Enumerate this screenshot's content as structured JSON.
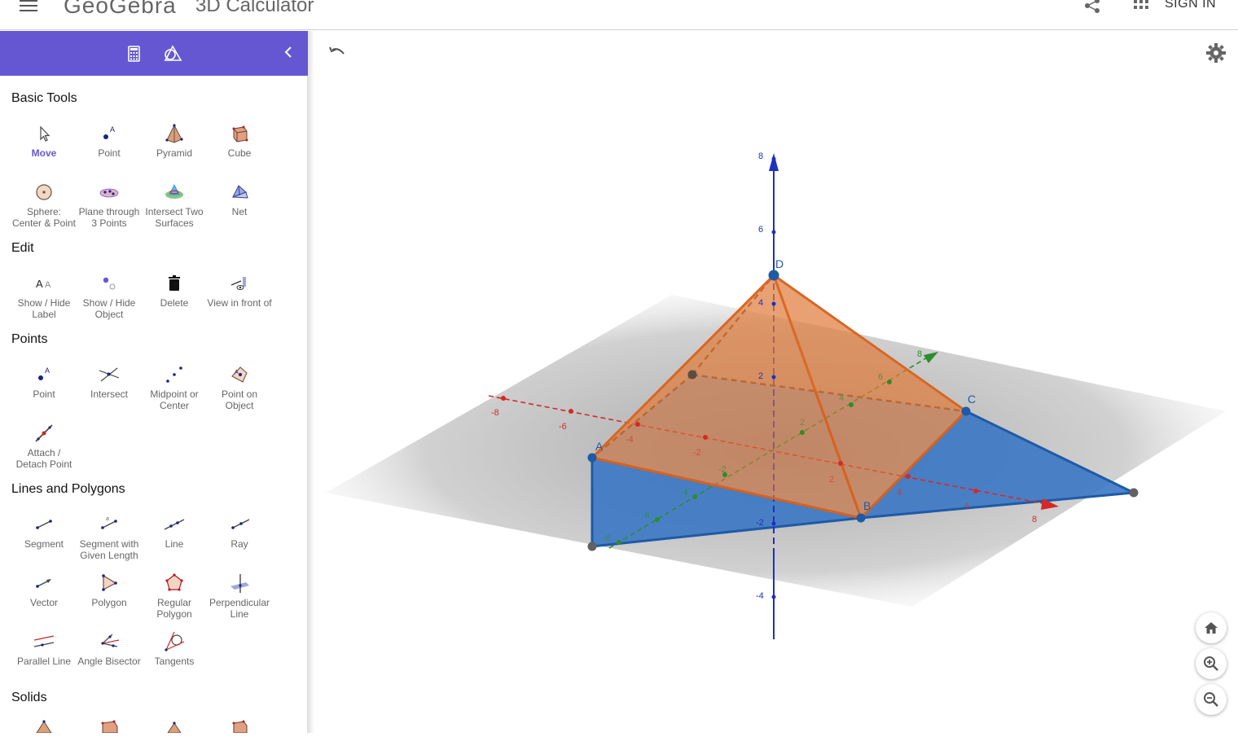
{
  "header": {
    "logo": "GeoGebra",
    "app_title": "3D Calculator",
    "sign_in": "SIGN IN"
  },
  "colors": {
    "accent": "#6557d2",
    "pyramid": "#e07a3a",
    "base_blue": "#3b78c4",
    "x_axis": "#d62828",
    "y_axis": "#2e8b2e",
    "z_axis": "#1f2fbf"
  },
  "sidebar": {
    "categories": {
      "basic": {
        "title": "Basic Tools",
        "tools": [
          {
            "label": "Move",
            "icon": "cursor-arrow-icon"
          },
          {
            "label": "Point",
            "icon": "point-icon"
          },
          {
            "label": "Pyramid",
            "icon": "pyramid-icon"
          },
          {
            "label": "Cube",
            "icon": "cube-icon"
          },
          {
            "label": "Sphere: Center & Point",
            "icon": "sphere-icon"
          },
          {
            "label": "Plane through 3 Points",
            "icon": "plane-icon"
          },
          {
            "label": "Intersect Two Surfaces",
            "icon": "intersect-surfaces-icon"
          },
          {
            "label": "Net",
            "icon": "net-icon"
          }
        ]
      },
      "edit": {
        "title": "Edit",
        "tools": [
          {
            "label": "Show / Hide Label",
            "icon": "label-icon"
          },
          {
            "label": "Show / Hide Object",
            "icon": "visibility-icon"
          },
          {
            "label": "Delete",
            "icon": "trash-icon"
          },
          {
            "label": "View in front of",
            "icon": "view-front-icon"
          }
        ]
      },
      "points": {
        "title": "Points",
        "tools": [
          {
            "label": "Point",
            "icon": "point-icon"
          },
          {
            "label": "Intersect",
            "icon": "intersect-icon"
          },
          {
            "label": "Midpoint or Center",
            "icon": "midpoint-icon"
          },
          {
            "label": "Point on Object",
            "icon": "point-on-object-icon"
          },
          {
            "label": "Attach / Detach Point",
            "icon": "attach-point-icon"
          }
        ]
      },
      "lines": {
        "title": "Lines and Polygons",
        "tools": [
          {
            "label": "Segment",
            "icon": "segment-icon"
          },
          {
            "label": "Segment with Given Length",
            "icon": "segment-length-icon"
          },
          {
            "label": "Line",
            "icon": "line-icon"
          },
          {
            "label": "Ray",
            "icon": "ray-icon"
          },
          {
            "label": "Vector",
            "icon": "vector-icon"
          },
          {
            "label": "Polygon",
            "icon": "polygon-icon"
          },
          {
            "label": "Regular Polygon",
            "icon": "regular-polygon-icon"
          },
          {
            "label": "Perpendicular Line",
            "icon": "perpendicular-icon"
          },
          {
            "label": "Parallel Line",
            "icon": "parallel-icon"
          },
          {
            "label": "Angle Bisector",
            "icon": "angle-bisector-icon"
          },
          {
            "label": "Tangents",
            "icon": "tangents-icon"
          }
        ]
      },
      "solids": {
        "title": "Solids"
      }
    }
  },
  "graphics": {
    "points": {
      "a": "A",
      "b": "B",
      "c": "C",
      "d": "D"
    },
    "z_ticks": [
      "8",
      "6",
      "4",
      "2",
      "-2",
      "-4"
    ],
    "x_ticks": [
      "-8",
      "-6",
      "-4",
      "-2",
      "2",
      "4",
      "6",
      "8"
    ],
    "y_ticks": [
      "8",
      "6",
      "4",
      "2",
      "-2",
      "-4",
      "-6",
      "-8"
    ]
  }
}
